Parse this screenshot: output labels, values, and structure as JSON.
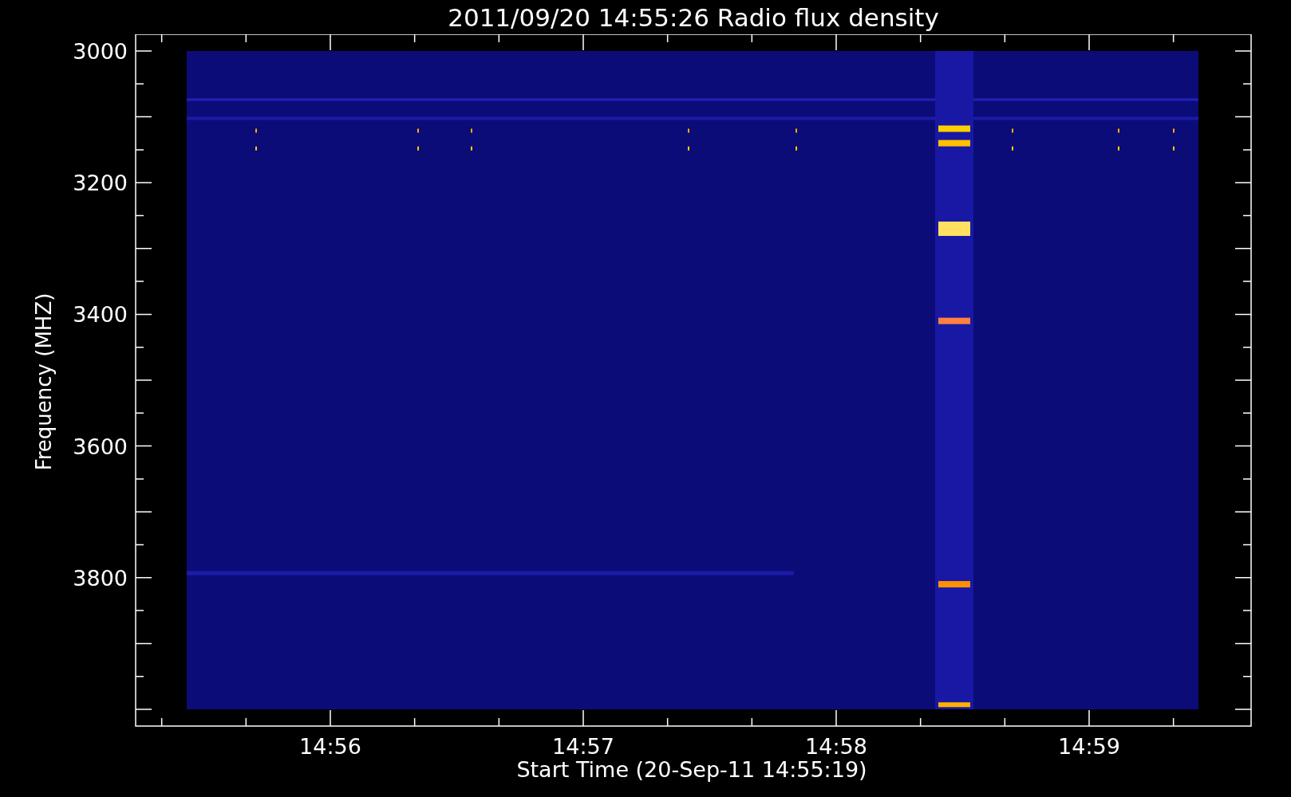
{
  "title": "2011/09/20 14:55:26 Radio flux density",
  "y_axis": {
    "label": "Frequency (MHZ)",
    "tick_labels": [
      "3000",
      "3200",
      "3400",
      "3600",
      "3800"
    ]
  },
  "x_axis": {
    "label": "Start Time (20-Sep-11 14:55:19)",
    "tick_labels": [
      "14:56",
      "14:57",
      "14:58",
      "14:59"
    ]
  }
}
